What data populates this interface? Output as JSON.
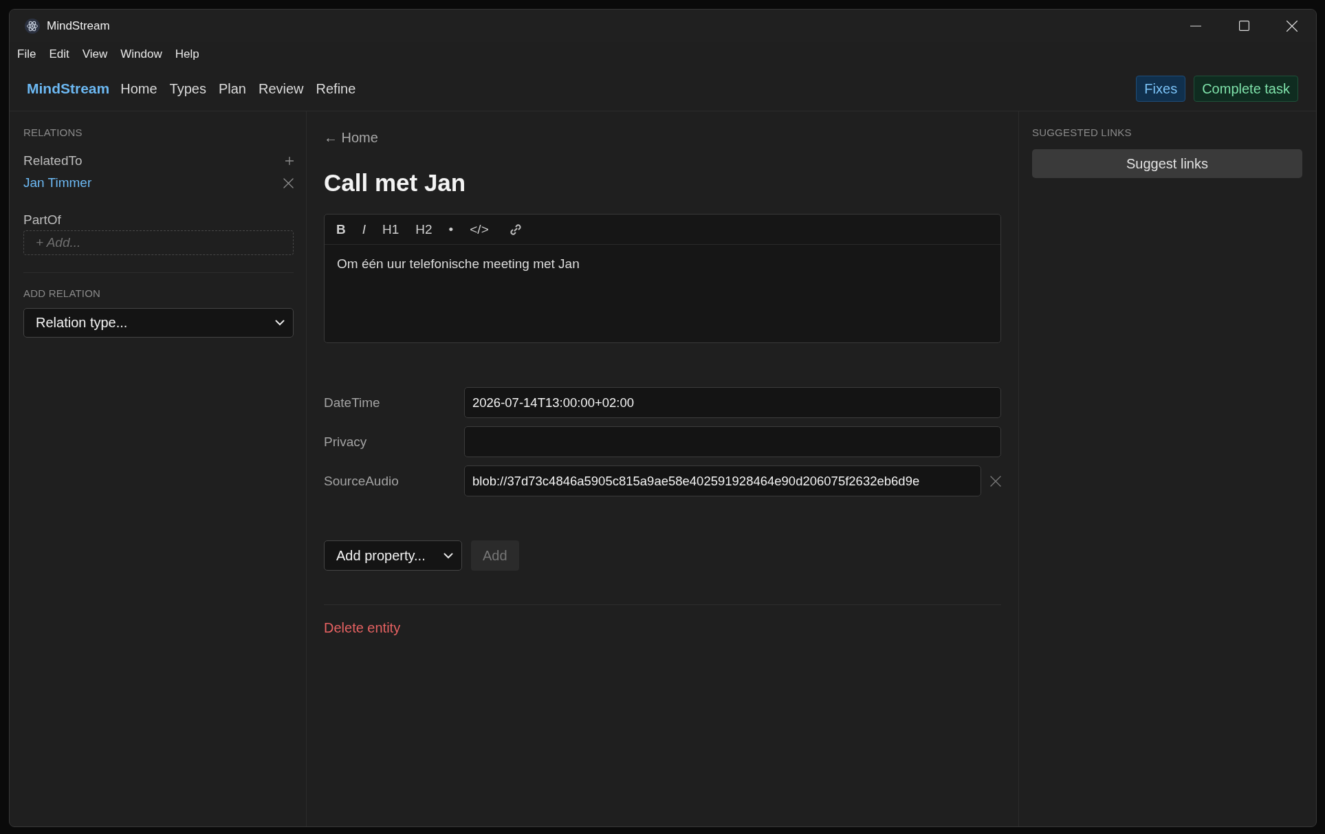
{
  "window": {
    "title": "MindStream"
  },
  "menu": [
    "File",
    "Edit",
    "View",
    "Window",
    "Help"
  ],
  "nav": {
    "brand": "MindStream",
    "items": [
      "Home",
      "Types",
      "Plan",
      "Review",
      "Refine"
    ]
  },
  "actions": [
    {
      "label": "Fixes",
      "kind": "info"
    },
    {
      "label": "Complete task",
      "kind": "success"
    }
  ],
  "relations": {
    "heading": "RELATIONS",
    "groups": [
      {
        "name": "RelatedTo",
        "entries": [
          "Jan Timmer"
        ]
      },
      {
        "name": "PartOf",
        "placeholder": "+ Add..."
      }
    ]
  },
  "add_relation": {
    "heading": "ADD RELATION",
    "select": "Relation type..."
  },
  "entity": {
    "breadcrumb": "← Home",
    "title": "Call met Jan",
    "toolbar": [
      {
        "label": "B",
        "kind": "bold"
      },
      {
        "label": "I",
        "kind": "italic"
      },
      {
        "label": "H1",
        "kind": "text"
      },
      {
        "label": "H2",
        "kind": "text"
      },
      {
        "label": "•",
        "kind": "text"
      },
      {
        "label": "</>",
        "kind": "text"
      },
      {
        "kind": "link"
      }
    ],
    "content": "Om één uur telefonische meeting met Jan",
    "properties": [
      {
        "name": "DateTime",
        "value": "2026-07-14T13:00:00+02:00",
        "removable": false
      },
      {
        "name": "Privacy",
        "removable": false
      },
      {
        "name": "SourceAudio",
        "value": "blob://37d73c4846a5905c815a9ae58e402591928464e90d206075f2632eb6d9e",
        "removable": true
      }
    ],
    "add_property": {
      "select": "Add property...",
      "button": "Add",
      "disabled": true
    },
    "delete": "Delete entity"
  },
  "suggested_links": {
    "heading": "SUGGESTED LINKS",
    "button": "Suggest links"
  }
}
